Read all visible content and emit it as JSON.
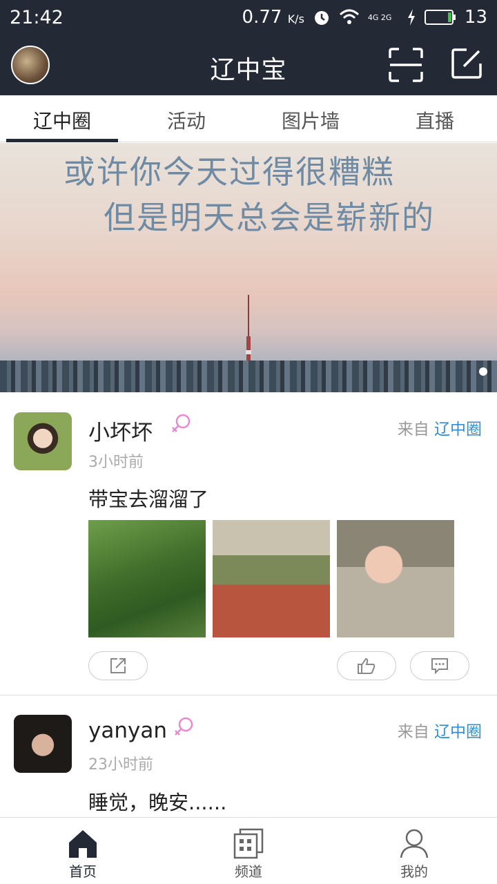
{
  "status": {
    "time": "21:42",
    "speed": "0.77",
    "speed_unit": "K/s",
    "network": "4G 2G",
    "battery": "13"
  },
  "app": {
    "title": "辽中宝"
  },
  "tabs": [
    {
      "label": "辽中圈",
      "active": true
    },
    {
      "label": "活动",
      "active": false
    },
    {
      "label": "图片墙",
      "active": false
    },
    {
      "label": "直播",
      "active": false
    }
  ],
  "banner": {
    "line1": "或许你今天过得很糟糕",
    "line2": "但是明天总会是崭新的"
  },
  "posts": [
    {
      "name": "小坏坏",
      "gender": "female",
      "time": "3小时前",
      "source_prefix": "来自",
      "source": "辽中圈",
      "text": "带宝去溜溜了",
      "photos": 3
    },
    {
      "name": "yanyan",
      "gender": "female",
      "time": "23小时前",
      "source_prefix": "来自",
      "source": "辽中圈",
      "text": "睡觉，晚安......"
    }
  ],
  "bottom_nav": [
    {
      "label": "首页",
      "icon": "home-icon",
      "active": true
    },
    {
      "label": "频道",
      "icon": "channel-grid-icon",
      "active": false
    },
    {
      "label": "我的",
      "icon": "user-icon",
      "active": false
    }
  ],
  "colors": {
    "header_bg": "#232a36",
    "link_blue": "#2f8fd0",
    "gender_pink": "#e88ad0"
  }
}
